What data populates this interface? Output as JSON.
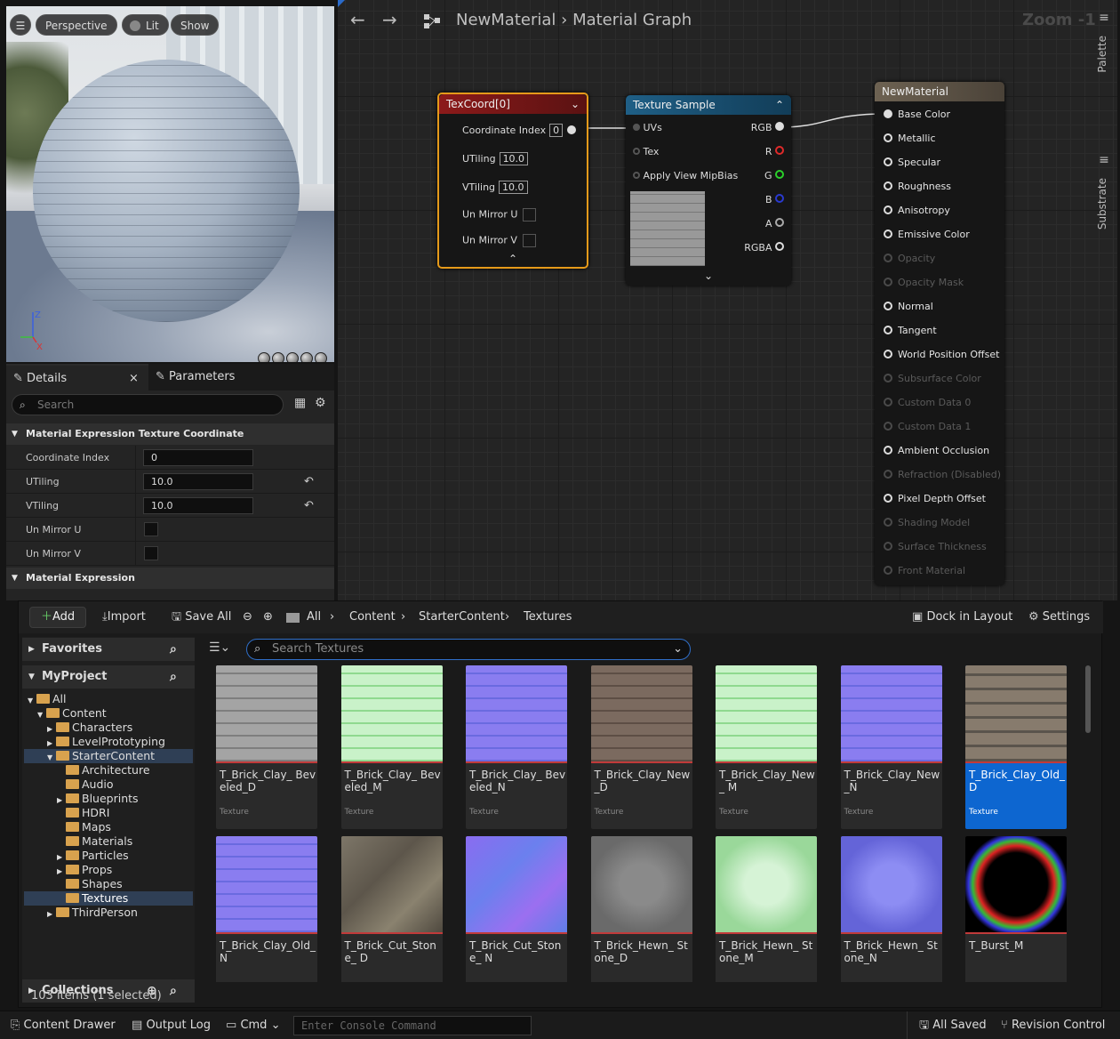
{
  "viewport": {
    "perspective": "Perspective",
    "lit": "Lit",
    "show": "Show",
    "axis_z": "Z",
    "axis_x": "X",
    "axis_y": "Y"
  },
  "details": {
    "tab_details": "Details",
    "tab_parameters": "Parameters",
    "search_placeholder": "Search",
    "section1": "Material Expression Texture Coordinate",
    "props": [
      {
        "label": "Coordinate Index",
        "value": "0"
      },
      {
        "label": "UTiling",
        "value": "10.0"
      },
      {
        "label": "VTiling",
        "value": "10.0"
      },
      {
        "label": "Un Mirror U"
      },
      {
        "label": "Un Mirror V"
      }
    ],
    "section2": "Material Expression"
  },
  "graph": {
    "breadcrumb_root": "NewMaterial",
    "breadcrumb_leaf": "Material Graph",
    "zoom": "Zoom -1",
    "palette": "Palette",
    "substrate": "Substrate",
    "texcoord": {
      "title": "TexCoord[0]",
      "coord_index_label": "Coordinate Index",
      "coord_index": "0",
      "utiling_label": "UTiling",
      "utiling": "10.0",
      "vtiling_label": "VTiling",
      "vtiling": "10.0",
      "unmirror_u": "Un Mirror U",
      "unmirror_v": "Un Mirror V"
    },
    "texsample": {
      "title": "Texture Sample",
      "uvs": "UVs",
      "tex": "Tex",
      "mip": "Apply View MipBias",
      "rgb": "RGB",
      "r": "R",
      "g": "G",
      "b": "B",
      "a": "A",
      "rgba": "RGBA"
    },
    "material": {
      "title": "NewMaterial",
      "pins": [
        {
          "label": "Base Color",
          "enabled": true,
          "connected": true
        },
        {
          "label": "Metallic",
          "enabled": true
        },
        {
          "label": "Specular",
          "enabled": true
        },
        {
          "label": "Roughness",
          "enabled": true
        },
        {
          "label": "Anisotropy",
          "enabled": true
        },
        {
          "label": "Emissive Color",
          "enabled": true
        },
        {
          "label": "Opacity",
          "enabled": false
        },
        {
          "label": "Opacity Mask",
          "enabled": false
        },
        {
          "label": "Normal",
          "enabled": true
        },
        {
          "label": "Tangent",
          "enabled": true
        },
        {
          "label": "World Position Offset",
          "enabled": true
        },
        {
          "label": "Subsurface Color",
          "enabled": false
        },
        {
          "label": "Custom Data 0",
          "enabled": false
        },
        {
          "label": "Custom Data 1",
          "enabled": false
        },
        {
          "label": "Ambient Occlusion",
          "enabled": true
        },
        {
          "label": "Refraction (Disabled)",
          "enabled": false
        },
        {
          "label": "Pixel Depth Offset",
          "enabled": true
        },
        {
          "label": "Shading Model",
          "enabled": false
        },
        {
          "label": "Surface Thickness",
          "enabled": false
        },
        {
          "label": "Front Material",
          "enabled": false
        }
      ]
    }
  },
  "content_browser": {
    "add": "Add",
    "import": "Import",
    "save_all": "Save All",
    "path": [
      "All",
      "Content",
      "StarterContent",
      "Textures"
    ],
    "dock": "Dock in Layout",
    "settings": "Settings",
    "favorites": "Favorites",
    "project": "MyProject",
    "collections": "Collections",
    "search_placeholder": "Search Textures",
    "tree": [
      {
        "label": "All",
        "level": 0,
        "open": true
      },
      {
        "label": "Content",
        "level": 1,
        "open": true
      },
      {
        "label": "Characters",
        "level": 2,
        "arrow": true
      },
      {
        "label": "LevelPrototyping",
        "level": 2,
        "arrow": true
      },
      {
        "label": "StarterContent",
        "level": 2,
        "open": true,
        "selected": true
      },
      {
        "label": "Architecture",
        "level": 3
      },
      {
        "label": "Audio",
        "level": 3
      },
      {
        "label": "Blueprints",
        "level": 3,
        "arrow": true
      },
      {
        "label": "HDRI",
        "level": 3
      },
      {
        "label": "Maps",
        "level": 3
      },
      {
        "label": "Materials",
        "level": 3
      },
      {
        "label": "Particles",
        "level": 3,
        "arrow": true
      },
      {
        "label": "Props",
        "level": 3,
        "arrow": true
      },
      {
        "label": "Shapes",
        "level": 3
      },
      {
        "label": "Textures",
        "level": 3,
        "selected": true,
        "strong": true
      },
      {
        "label": "ThirdPerson",
        "level": 2,
        "arrow": true
      }
    ],
    "assets": [
      {
        "name": "T_Brick_Clay_ Beveled_D",
        "type": "Texture",
        "kind": "gray"
      },
      {
        "name": "T_Brick_Clay_ Beveled_M",
        "type": "Texture",
        "kind": "green"
      },
      {
        "name": "T_Brick_Clay_ Beveled_N",
        "type": "Texture",
        "kind": "blue"
      },
      {
        "name": "T_Brick_Clay_New_D",
        "type": "Texture",
        "kind": "brown"
      },
      {
        "name": "T_Brick_Clay_New_ M",
        "type": "Texture",
        "kind": "green"
      },
      {
        "name": "T_Brick_Clay_New_N",
        "type": "Texture",
        "kind": "blue"
      },
      {
        "name": "T_Brick_Clay_Old_D",
        "type": "Texture",
        "kind": "old",
        "selected": true
      },
      {
        "name": "T_Brick_Clay_Old_N",
        "type": "",
        "kind": "blue"
      },
      {
        "name": "T_Brick_Cut_Stone_ D",
        "type": "",
        "kind": "stone"
      },
      {
        "name": "T_Brick_Cut_Stone_ N",
        "type": "",
        "kind": "bluestone"
      },
      {
        "name": "T_Brick_Hewn_ Stone_D",
        "type": "",
        "kind": "hewn"
      },
      {
        "name": "T_Brick_Hewn_ Stone_M",
        "type": "",
        "kind": "hewngreen"
      },
      {
        "name": "T_Brick_Hewn_ Stone_N",
        "type": "",
        "kind": "hewnblue"
      },
      {
        "name": "T_Burst_M",
        "type": "",
        "kind": "burst"
      }
    ],
    "status": "103 items (1 selected)"
  },
  "bottom": {
    "drawer": "Content Drawer",
    "output": "Output Log",
    "cmd": "Cmd",
    "console_placeholder": "Enter Console Command",
    "saved": "All Saved",
    "revision": "Revision Control"
  }
}
